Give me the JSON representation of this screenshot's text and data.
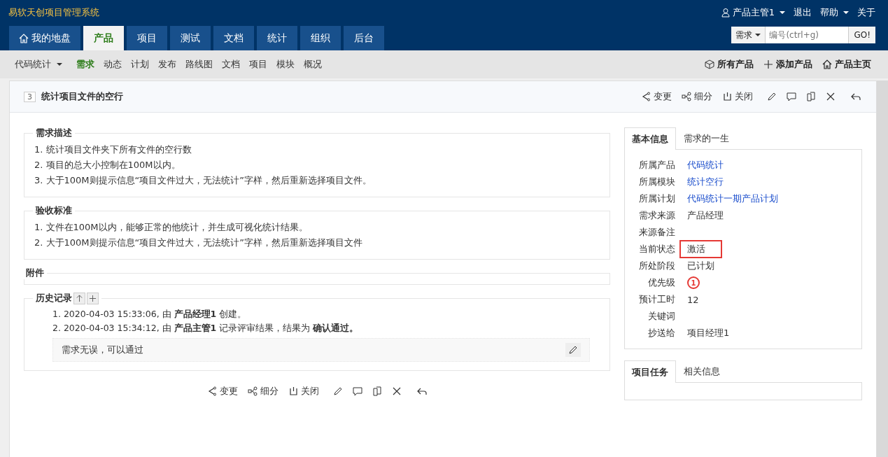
{
  "app_title": "易软天创项目管理系统",
  "user_menu": {
    "user": "产品主管1",
    "logout": "退出",
    "help": "帮助",
    "about": "关于"
  },
  "nav_tabs": [
    {
      "label": "我的地盘",
      "selected": false,
      "kind": "home"
    },
    {
      "label": "产品",
      "selected": true,
      "kind": "plain"
    },
    {
      "label": "项目",
      "selected": false,
      "kind": "plain"
    },
    {
      "label": "测试",
      "selected": false,
      "kind": "plain"
    },
    {
      "label": "文档",
      "selected": false,
      "kind": "plain"
    },
    {
      "label": "统计",
      "selected": false,
      "kind": "plain"
    },
    {
      "label": "组织",
      "selected": false,
      "kind": "plain"
    },
    {
      "label": "后台",
      "selected": false,
      "kind": "plain"
    }
  ],
  "search": {
    "type": "需求",
    "placeholder": "编号(ctrl+g)",
    "go": "GO!"
  },
  "subnav": {
    "product": "代码统计",
    "items": [
      {
        "label": "需求",
        "selected": true
      },
      {
        "label": "动态",
        "selected": false
      },
      {
        "label": "计划",
        "selected": false
      },
      {
        "label": "发布",
        "selected": false
      },
      {
        "label": "路线图",
        "selected": false
      },
      {
        "label": "文档",
        "selected": false
      },
      {
        "label": "项目",
        "selected": false
      },
      {
        "label": "模块",
        "selected": false
      },
      {
        "label": "概况",
        "selected": false
      }
    ],
    "links": [
      {
        "label": "所有产品",
        "kind": "box"
      },
      {
        "label": "添加产品",
        "kind": "plus"
      },
      {
        "label": "产品主页",
        "kind": "home"
      }
    ]
  },
  "story": {
    "id": "3",
    "title": "统计项目文件的空行"
  },
  "top_actions": [
    {
      "label": "变更",
      "kind": "change"
    },
    {
      "label": "细分",
      "kind": "split"
    },
    {
      "label": "关闭",
      "kind": "close"
    },
    {
      "kind": "edit"
    },
    {
      "kind": "comment"
    },
    {
      "kind": "copy"
    },
    {
      "kind": "delete"
    },
    {
      "kind": "back"
    }
  ],
  "description": {
    "title": "需求描述",
    "lines": [
      "1. 统计项目文件夹下所有文件的空行数",
      "2. 项目的总大小控制在100M以内。",
      "3. 大于100M则提示信息“项目文件过大，无法统计”字样，然后重新选择项目文件。"
    ]
  },
  "acceptance": {
    "title": "验收标准",
    "lines": [
      "1. 文件在100M以内，能够正常的他统计，并生成可视化统计结果。",
      "2. 大于100M则提示信息“项目文件过大，无法统计”字样，然后重新选择项目文件"
    ]
  },
  "attachments": {
    "title": "附件"
  },
  "history": {
    "title": "历史记录",
    "entries": [
      "1. 2020-04-03 15:33:06, 由 **产品经理1** 创建。",
      "2. 2020-04-03 15:34:12, 由 **产品主管1** 记录评审结果，结果为 **确认通过。**"
    ],
    "comment": "需求无误，可以通过"
  },
  "bottom_actions": [
    {
      "label": "变更",
      "kind": "change"
    },
    {
      "label": "细分",
      "kind": "split"
    },
    {
      "label": "关闭",
      "kind": "close"
    },
    {
      "kind": "edit"
    },
    {
      "kind": "comment"
    },
    {
      "kind": "copy"
    },
    {
      "kind": "delete"
    },
    {
      "kind": "back"
    }
  ],
  "info_tabs": [
    {
      "label": "基本信息",
      "selected": true
    },
    {
      "label": "需求的一生",
      "selected": false
    }
  ],
  "fields": [
    {
      "label": "所属产品",
      "value": "代码统计",
      "kind": "link",
      "highlighted": false
    },
    {
      "label": "所属模块",
      "value": "统计空行",
      "kind": "link",
      "highlighted": false
    },
    {
      "label": "所属计划",
      "value": "代码统计一期产品计划",
      "kind": "link",
      "highlighted": false
    },
    {
      "label": "需求来源",
      "value": "产品经理",
      "kind": "text",
      "highlighted": false
    },
    {
      "label": "来源备注"
    },
    {
      "label": "当前状态",
      "value": "激活",
      "kind": "text",
      "highlighted": true
    },
    {
      "label": "所处阶段",
      "value": "已计划",
      "kind": "text",
      "highlighted": false
    },
    {
      "label": "优先级",
      "value": "1",
      "kind": "priority",
      "highlighted": false
    },
    {
      "label": "预计工时",
      "value": "12",
      "kind": "text",
      "highlighted": false
    },
    {
      "label": "关键词"
    },
    {
      "label": "抄送给",
      "value": "项目经理1",
      "kind": "text",
      "highlighted": false
    }
  ],
  "task_tabs": [
    {
      "label": "项目任务",
      "selected": true
    },
    {
      "label": "相关信息",
      "selected": false
    }
  ]
}
